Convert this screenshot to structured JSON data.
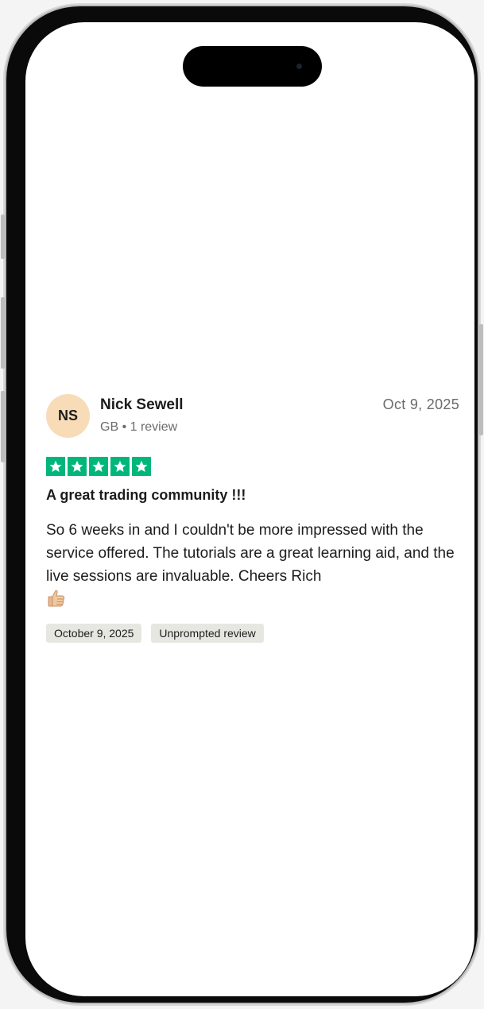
{
  "review": {
    "avatar_initials": "NS",
    "name": "Nick Sewell",
    "meta": "GB • 1 review",
    "date": "Oct 9, 2025",
    "rating": 5,
    "rating_color": "#00b67a",
    "title": "A great trading community !!!",
    "body": "So 6 weeks in and I couldn't be more impressed with the service offered. The tutorials are a great learning aid, and the live sessions are invaluable. Cheers Rich",
    "emoji_icon": "thumbs-up-icon",
    "tags": [
      "October 9, 2025",
      "Unprompted review"
    ]
  }
}
